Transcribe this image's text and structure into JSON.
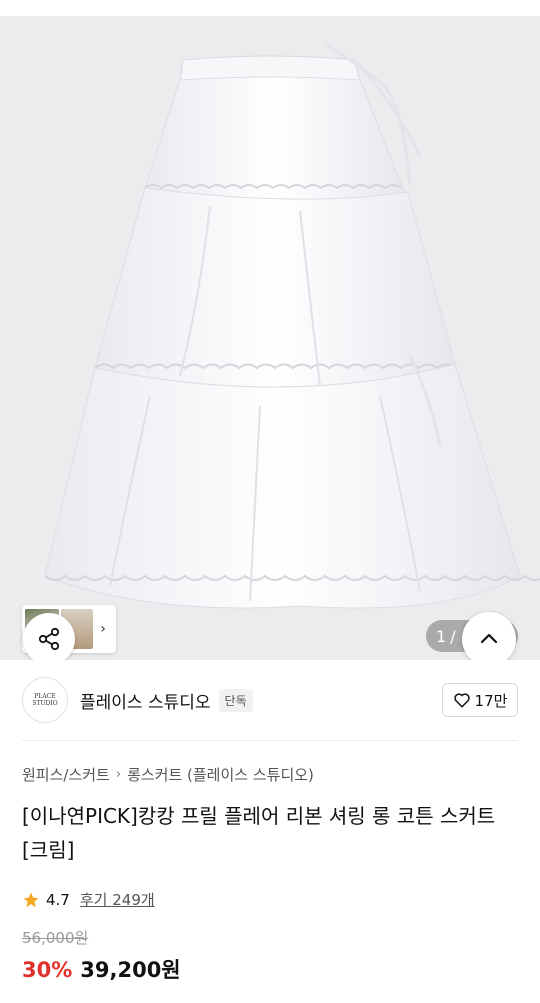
{
  "gallery": {
    "counter_current": "1",
    "counter_sep": "/",
    "share_icon": "share-icon",
    "up_icon": "chevron-up-icon",
    "thumb_next_icon": "chevron-right-icon"
  },
  "brand": {
    "logo_text": "PLACE STUDIO",
    "name": "플레이스 스튜디오",
    "badge": "단독",
    "like_count": "17만",
    "like_icon": "heart-outline-icon"
  },
  "breadcrumb": {
    "items": [
      "원피스/스커트",
      "롱스커트 (플레이스 스튜디오)"
    ]
  },
  "product": {
    "title": "[이나연PICK]캉캉 프릴 플레어 리본 셔링 롱 코튼 스커트 [크림]",
    "rating": "4.7",
    "reviews": "후기 249개",
    "original_price": "56,000원",
    "discount": "30%",
    "sale_price": "39,200원"
  },
  "colors": {
    "discount": "#e0322a",
    "star": "#f5a623"
  }
}
